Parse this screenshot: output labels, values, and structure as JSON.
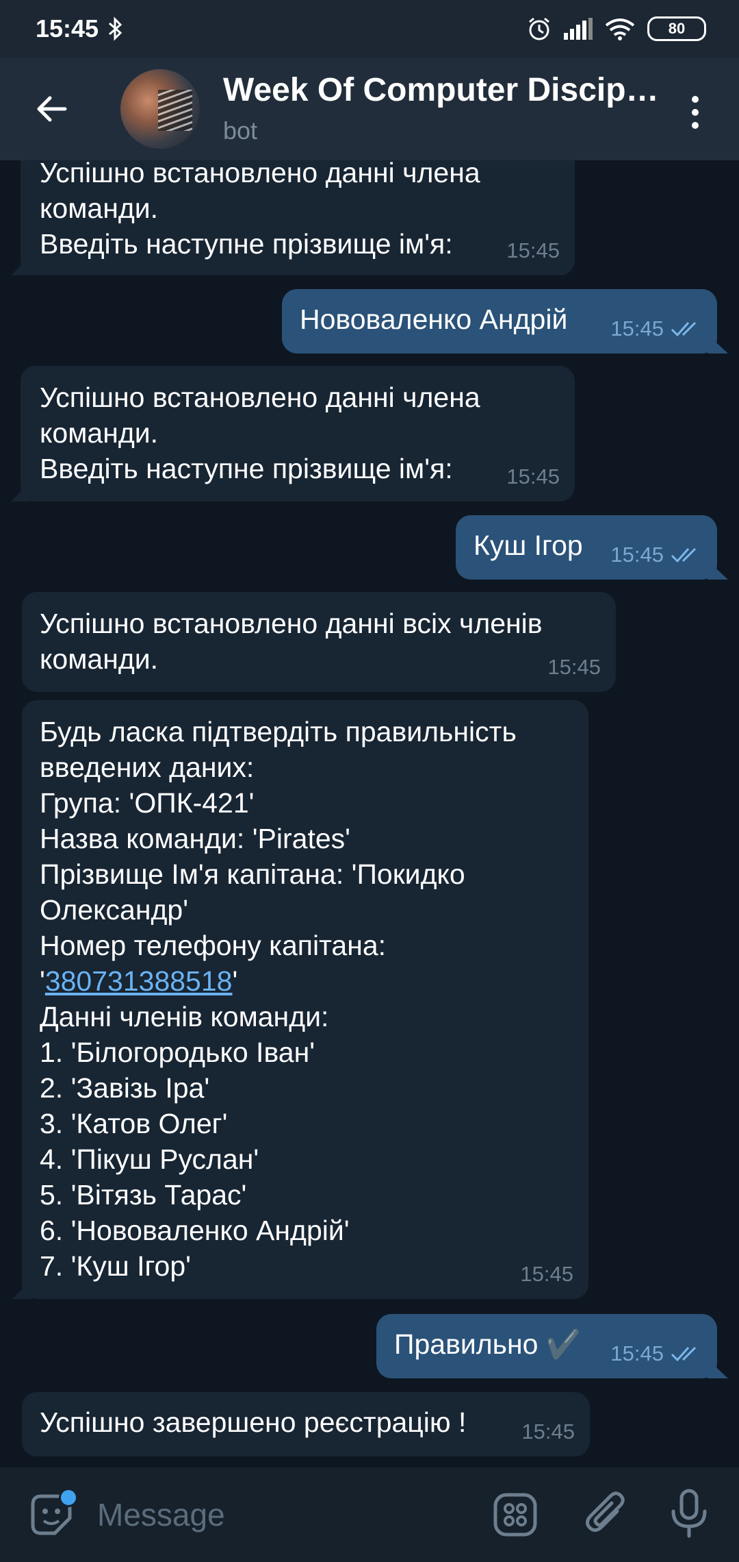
{
  "status_bar": {
    "time": "15:45",
    "battery": "80"
  },
  "header": {
    "title": "Week Of Computer Discipl…",
    "subtitle": "bot"
  },
  "messages": [
    {
      "text": "Успішно встановлено данні члена\nкоманди.\nВведіть наступне прізвище ім'я:",
      "time": "15:45"
    },
    {
      "text": "Нововаленко Андрій",
      "time": "15:45"
    },
    {
      "text": "Успішно встановлено данні члена\nкоманди.\nВведіть наступне прізвище ім'я:",
      "time": "15:45"
    },
    {
      "text": "Куш Ігор",
      "time": "15:45"
    },
    {
      "text": "Успішно встановлено данні всіх членів\nкоманди.",
      "time": "15:45"
    },
    {
      "text_before": "Будь ласка підтвердіть правильність\nвведених даних:\nГрупа: 'ОПК-421'\nНазва команди: 'Pirates'\nПрізвище Ім'я капітана: 'Покидко\nОлександр'\nНомер телефону капітана:\n'",
      "phone": "380731388518",
      "text_after": "'\nДанні членів команди:\n1. 'Білогородько Іван'\n2. 'Завізь Іра'\n3. 'Катов Олег'\n4. 'Пікуш Руслан'\n5. 'Вітязь Тарас'\n6. 'Нововаленко Андрій'\n7. 'Куш Ігор'",
      "time": "15:45"
    },
    {
      "text": "Правильно ✔️",
      "time": "15:45"
    },
    {
      "text": "Успішно завершено реєстрацію !",
      "time": "15:45"
    }
  ],
  "composer": {
    "placeholder": "Message"
  },
  "colors": {
    "accent": "#6ab3f3",
    "outgoing": "#2b5278",
    "incoming": "#182533"
  }
}
